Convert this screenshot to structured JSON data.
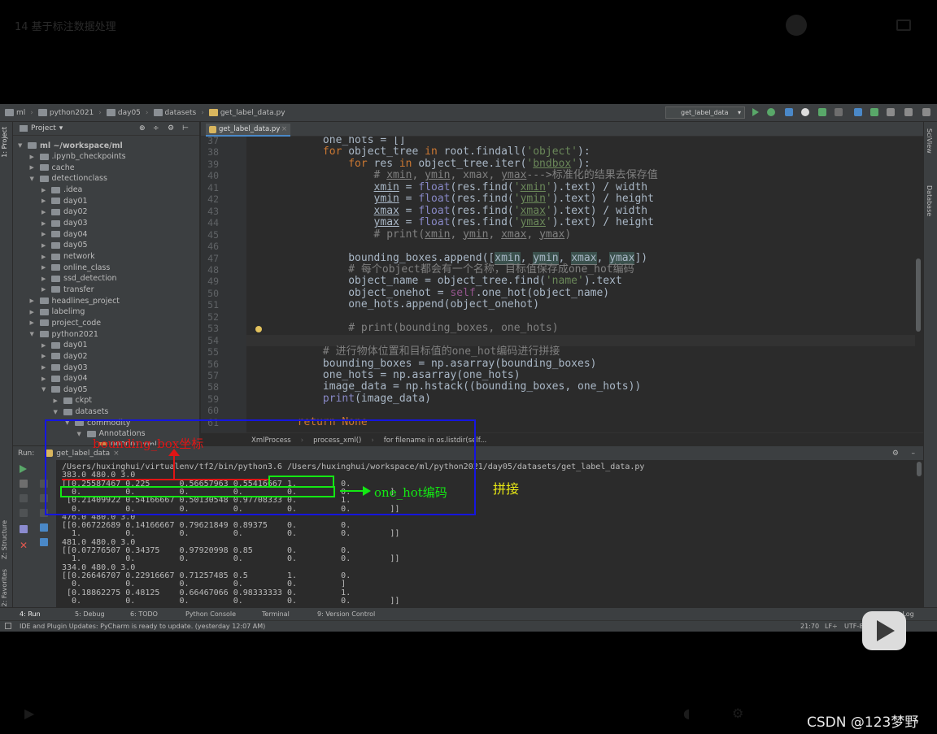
{
  "player": {
    "top_title": "14 基于标注数据处理",
    "watermark": "CSDN @123梦野"
  },
  "navbar": {
    "crumbs": [
      "ml",
      "python2021",
      "day05",
      "datasets",
      "get_label_data.py"
    ],
    "run_config": "get_label_data"
  },
  "left_strip": {
    "project_tab": "1: Project",
    "structure_tab": "Z: Structure",
    "favorites_tab": "2: Favorites"
  },
  "right_strip": {
    "sciview_tab": "SciView",
    "database_tab": "Database"
  },
  "project": {
    "header": "Project",
    "items": [
      {
        "label": "ml  ~/workspace/ml",
        "depth": 0,
        "open": true,
        "bold": true
      },
      {
        "label": ".ipynb_checkpoints",
        "depth": 1
      },
      {
        "label": "cache",
        "depth": 1
      },
      {
        "label": "detectionclass",
        "depth": 1,
        "open": true
      },
      {
        "label": ".idea",
        "depth": 2
      },
      {
        "label": "day01",
        "depth": 2
      },
      {
        "label": "day02",
        "depth": 2
      },
      {
        "label": "day03",
        "depth": 2
      },
      {
        "label": "day04",
        "depth": 2
      },
      {
        "label": "day05",
        "depth": 2
      },
      {
        "label": "network",
        "depth": 2
      },
      {
        "label": "online_class",
        "depth": 2
      },
      {
        "label": "ssd_detection",
        "depth": 2
      },
      {
        "label": "transfer",
        "depth": 2
      },
      {
        "label": "headlines_project",
        "depth": 1
      },
      {
        "label": "labelimg",
        "depth": 1
      },
      {
        "label": "project_code",
        "depth": 1
      },
      {
        "label": "python2021",
        "depth": 1,
        "open": true
      },
      {
        "label": "day01",
        "depth": 2
      },
      {
        "label": "day02",
        "depth": 2
      },
      {
        "label": "day03",
        "depth": 2
      },
      {
        "label": "day04",
        "depth": 2
      },
      {
        "label": "day05",
        "depth": 2,
        "open": true
      },
      {
        "label": "ckpt",
        "depth": 3
      },
      {
        "label": "datasets",
        "depth": 3,
        "open": true
      },
      {
        "label": "commodity",
        "depth": 4,
        "open": true
      },
      {
        "label": "Annotations",
        "depth": 5,
        "open": true
      },
      {
        "label": "000001.xml",
        "depth": 6,
        "file": true
      }
    ]
  },
  "editor": {
    "tab": "get_label_data.py",
    "lines": [
      {
        "n": "37",
        "html": "            one_hots = []"
      },
      {
        "n": "38",
        "html": "            <span class=\"kw\">for</span> object_tree <span class=\"kw\">in</span> root.findall(<span class=\"str\">'object'</span>):"
      },
      {
        "n": "39",
        "html": "                <span class=\"kw\">for</span> res <span class=\"kw\">in</span> object_tree.iter(<span class=\"str\">'<u>bndbox</u>'</span>):"
      },
      {
        "n": "40",
        "html": "                    <span class=\"cm\"># <u>xmin</u>, <u>ymin</u>, xmax, <u>ymax</u>--->标准化的结果去保存值</span>"
      },
      {
        "n": "41",
        "html": "                    <u>xmin</u> = <span class=\"fn\">float</span>(res.find(<span class=\"str\">'<u>xmin</u>'</span>).text) / width"
      },
      {
        "n": "42",
        "html": "                    <u>ymin</u> = <span class=\"fn\">float</span>(res.find(<span class=\"str\">'<u>ymin</u>'</span>).text) / height"
      },
      {
        "n": "43",
        "html": "                    <u>xmax</u> = <span class=\"fn\">float</span>(res.find(<span class=\"str\">'<u>xmax</u>'</span>).text) / width"
      },
      {
        "n": "44",
        "html": "                    <u>ymax</u> = <span class=\"fn\">float</span>(res.find(<span class=\"str\">'<u>ymax</u>'</span>).text) / height"
      },
      {
        "n": "45",
        "html": "                    <span class=\"cm\"># print(<u>xmin</u>, <u>ymin</u>, <u>xmax</u>, <u>ymax</u>)</span>"
      },
      {
        "n": "46",
        "html": ""
      },
      {
        "n": "47",
        "html": "                bounding_boxes.append([<span class=\"hl\">xmin</span>, <span class=\"hl\">ymin</span>, <span class=\"hl\">xmax</span>, <span class=\"hl\">ymax</span>])"
      },
      {
        "n": "48",
        "html": "                <span class=\"cm\"># 每个object都会有一个名称，目标值保存成one_hot编码</span>"
      },
      {
        "n": "49",
        "html": "                object_name = object_tree.find(<span class=\"str\">'name'</span>).text"
      },
      {
        "n": "50",
        "html": "                object_onehot = <span class=\"self\">self</span>.one_hot(object_name)"
      },
      {
        "n": "51",
        "html": "                one_hots.append(object_onehot)"
      },
      {
        "n": "52",
        "html": ""
      },
      {
        "n": "53",
        "html": "                <span class=\"cm\"># print(bounding_boxes, one_hots)</span>"
      },
      {
        "n": "54",
        "html": ""
      },
      {
        "n": "55",
        "html": "            <span class=\"cm\"># 进行物体位置和目标值的one_hot编码进行拼接</span>"
      },
      {
        "n": "56",
        "html": "            bounding_boxes = np.asarray(bounding_boxes)"
      },
      {
        "n": "57",
        "html": "            one_hots = np.asarray(one_hots)"
      },
      {
        "n": "58",
        "html": "            image_data = np.hstack((bounding_boxes, one_hots))"
      },
      {
        "n": "59",
        "html": "            <span class=\"fn\">print</span>(image_data)"
      },
      {
        "n": "60",
        "html": ""
      },
      {
        "n": "61",
        "html": "        <span class=\"kw\">return None</span>"
      }
    ],
    "breadcrumb": [
      "XmlProcess",
      "process_xml()",
      "for filename in os.listdir(self..."
    ]
  },
  "run": {
    "label": "Run:",
    "tab": "get_label_data",
    "console": [
      "/Users/huxinghui/virtualenv/tf2/bin/python3.6 /Users/huxinghui/workspace/ml/python2021/day05/datasets/get_label_data.py",
      "383.0 480.0 3.0",
      "[[0.25587467 0.225      0.56657963 0.55416667 1.         0.",
      "  0.         0.         0.         0.         0.         0.        ]",
      " [0.21409922 0.54166667 0.50130548 0.97708333 0.         1.",
      "  0.         0.         0.         0.         0.         0.        ]]",
      "476.0 480.0 3.0",
      "[[0.06722689 0.14166667 0.79621849 0.89375    0.         0.",
      "  1.         0.         0.         0.         0.         0.        ]]",
      "481.0 480.0 3.0",
      "[[0.07276507 0.34375    0.97920998 0.85       0.         0.",
      "  1.         0.         0.         0.         0.         0.        ]]",
      "334.0 480.0 3.0",
      "[[0.26646707 0.22916667 0.71257485 0.5        1.         0.",
      "  0.         0.         0.         0.         0.         ]",
      " [0.18862275 0.48125    0.66467066 0.98333333 0.         1.",
      "  0.         0.         0.         0.         0.         0.        ]]"
    ]
  },
  "tool_tabs": [
    "4: Run",
    "5: Debug",
    "6: TODO",
    "Python Console",
    "Terminal",
    "9: Version Control",
    "Event Log"
  ],
  "status": {
    "message": "IDE and Plugin Updates: PyCharm is ready to update. (yesterday 12:07 AM)",
    "position": "21:70",
    "line_sep": "LF÷",
    "encoding": "UTF-8"
  },
  "annotations": {
    "bbox_label": "bounding_box坐标",
    "onehot_label": "one_hot编码",
    "concat_label": "拼接"
  },
  "colors": {
    "annotation_blue": "#1515e0",
    "annotation_green": "#13e813",
    "annotation_red": "#e01515",
    "annotation_yellow": "#e8e814"
  }
}
